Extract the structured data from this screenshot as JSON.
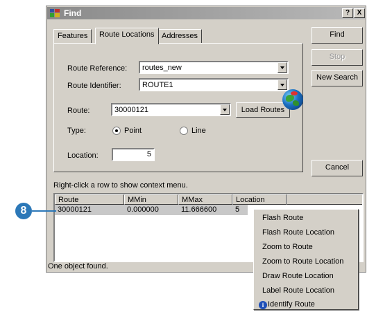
{
  "window": {
    "title": "Find",
    "help_label": "?",
    "close_label": "X"
  },
  "tabs": [
    {
      "label": "Features"
    },
    {
      "label": "Route Locations"
    },
    {
      "label": "Addresses"
    }
  ],
  "form": {
    "route_reference": {
      "label": "Route Reference:",
      "value": "routes_new"
    },
    "route_identifier": {
      "label": "Route Identifier:",
      "value": "ROUTE1"
    },
    "route": {
      "label": "Route:",
      "value": "30000121"
    },
    "load_routes_label": "Load Routes",
    "type": {
      "label": "Type:",
      "options": [
        "Point",
        "Line"
      ],
      "selected": "Point"
    },
    "location": {
      "label": "Location:",
      "value": "5"
    }
  },
  "buttons": {
    "find": "Find",
    "stop": "Stop",
    "new_search": "New Search",
    "cancel": "Cancel"
  },
  "results": {
    "hint": "Right-click a row to show context menu.",
    "columns": [
      "Route",
      "MMin",
      "MMax",
      "Location"
    ],
    "rows": [
      [
        "30000121",
        "0.000000",
        "11.666600",
        "5"
      ]
    ],
    "status": "One object found."
  },
  "context_menu": {
    "items": [
      "Flash Route",
      "Flash Route Location",
      "Zoom to Route",
      "Zoom to Route Location",
      "Draw Route Location",
      "Label Route Location",
      "Identify Route"
    ]
  },
  "callout": {
    "number": "8",
    "color": "#2c78b8"
  }
}
